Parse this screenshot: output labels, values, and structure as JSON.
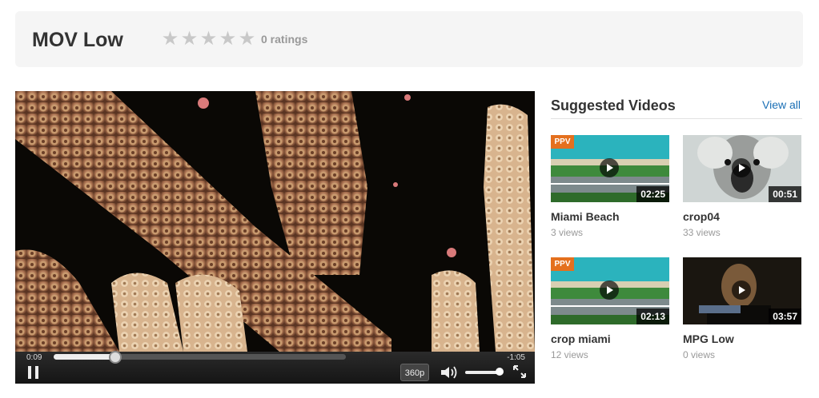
{
  "video": {
    "title": "MOV Low",
    "rating_text": "0 ratings",
    "stars": [
      1,
      2,
      3,
      4,
      5
    ]
  },
  "player": {
    "current_time": "0:09",
    "remaining_time": "-1:05",
    "progress": 0.21,
    "quality": "360p",
    "volume": 0.9
  },
  "sidebar": {
    "heading": "Suggested Videos",
    "view_all": "View all",
    "videos": [
      {
        "title": "Miami Beach",
        "views": "3 views",
        "duration": "02:25",
        "badge": "PPV",
        "thumb": "beach"
      },
      {
        "title": "crop04",
        "views": "33 views",
        "duration": "00:51",
        "badge": "",
        "thumb": "koala"
      },
      {
        "title": "crop miami",
        "views": "12 views",
        "duration": "02:13",
        "badge": "PPV",
        "thumb": "beach"
      },
      {
        "title": "MPG Low",
        "views": "0 views",
        "duration": "03:57",
        "badge": "",
        "thumb": "man"
      }
    ]
  },
  "colors": {
    "accent": "#1a6fb5",
    "ppv": "#e4701e"
  },
  "icons": {
    "star": "star-icon",
    "pause": "pause-icon",
    "volume": "volume-icon",
    "fullscreen": "fullscreen-icon",
    "play": "play-icon"
  }
}
